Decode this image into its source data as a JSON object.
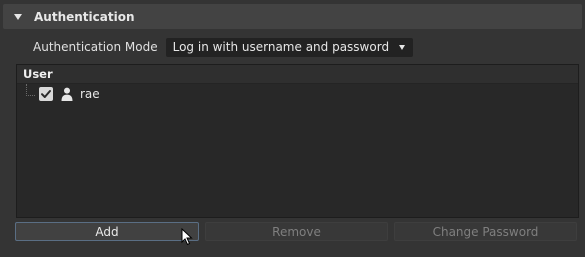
{
  "section": {
    "title": "Authentication"
  },
  "mode": {
    "label": "Authentication Mode",
    "selected": "Log in with username and password"
  },
  "user_list": {
    "header": "User",
    "rows": [
      {
        "name": "rae",
        "checked": true
      }
    ]
  },
  "buttons": {
    "add": "Add",
    "remove": "Remove",
    "change_password": "Change Password"
  },
  "colors": {
    "background": "#343434",
    "header_bg": "#434343",
    "list_bg": "#282828",
    "focus_border": "#5a6e84"
  }
}
